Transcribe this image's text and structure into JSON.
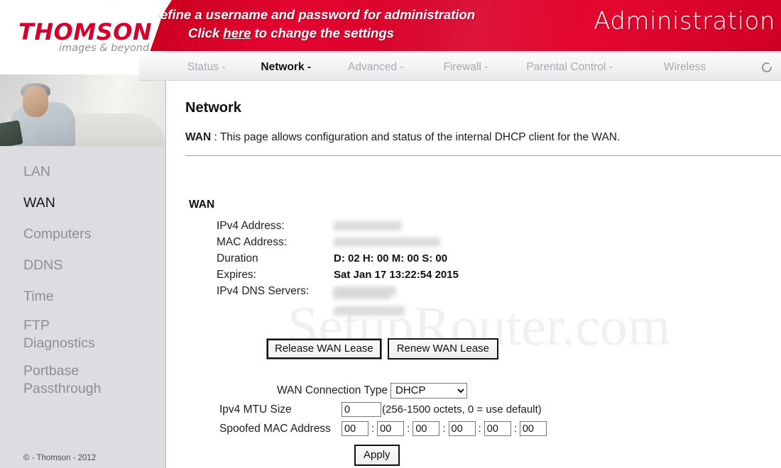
{
  "brand": {
    "logo_name": "THOMSON",
    "logo_tagline": "images & beyond",
    "accent_red": "#d8022a",
    "header_title": "Administration"
  },
  "banner": {
    "line1": "Please define a username and password for administration",
    "line2_prefix": "Click ",
    "line2_link": "here",
    "line2_suffix": " to change the settings"
  },
  "nav": {
    "items": [
      {
        "label": "Status -",
        "active": false
      },
      {
        "label": "Network -",
        "active": true
      },
      {
        "label": "Advanced -",
        "active": false
      },
      {
        "label": "Firewall -",
        "active": false
      },
      {
        "label": "Parental Control -",
        "active": false
      },
      {
        "label": "Wireless",
        "active": false
      }
    ],
    "refresh_icon": "refresh-icon"
  },
  "sidebar": {
    "items": [
      {
        "label": "LAN",
        "active": false
      },
      {
        "label": "WAN",
        "active": true
      },
      {
        "label": "Computers",
        "active": false
      },
      {
        "label": "DDNS",
        "active": false
      },
      {
        "label": "Time",
        "active": false
      },
      {
        "label": "FTP Diagnostics",
        "active": false
      },
      {
        "label": "Portbase Passthrough",
        "active": false
      }
    ],
    "footer": "© - Thomson - 2012"
  },
  "main": {
    "title": "Network",
    "desc_label": "WAN",
    "desc_separator": ":",
    "desc_text": "This page allows configuration and status of the internal DHCP client for the WAN.",
    "watermark": "SetupRouter.com",
    "section_title": "WAN",
    "status": [
      {
        "label": "IPv4 Address:",
        "value": "",
        "redacted": true
      },
      {
        "label": "MAC Address:",
        "value": "",
        "redacted": true
      },
      {
        "label": "Duration",
        "value": "D: 02 H: 00 M: 00 S: 00",
        "redacted": false
      },
      {
        "label": "Expires:",
        "value": "Sat Jan 17 13:22:54 2015",
        "redacted": false
      },
      {
        "label": "IPv4 DNS Servers:",
        "value": "",
        "redacted": true
      }
    ],
    "buttons": {
      "release": "Release WAN Lease",
      "renew": "Renew WAN Lease",
      "apply": "Apply"
    },
    "form": {
      "conn_type_label": "WAN Connection Type",
      "conn_type_value": "DHCP",
      "conn_type_options": [
        "DHCP"
      ],
      "mtu_label": "Ipv4 MTU Size",
      "mtu_value": "0",
      "mtu_hint": "(256-1500 octets, 0 = use default)",
      "mac_label": "Spoofed MAC Address",
      "mac_octets": [
        "00",
        "00",
        "00",
        "00",
        "00",
        "00"
      ],
      "mac_separator": ":"
    }
  }
}
